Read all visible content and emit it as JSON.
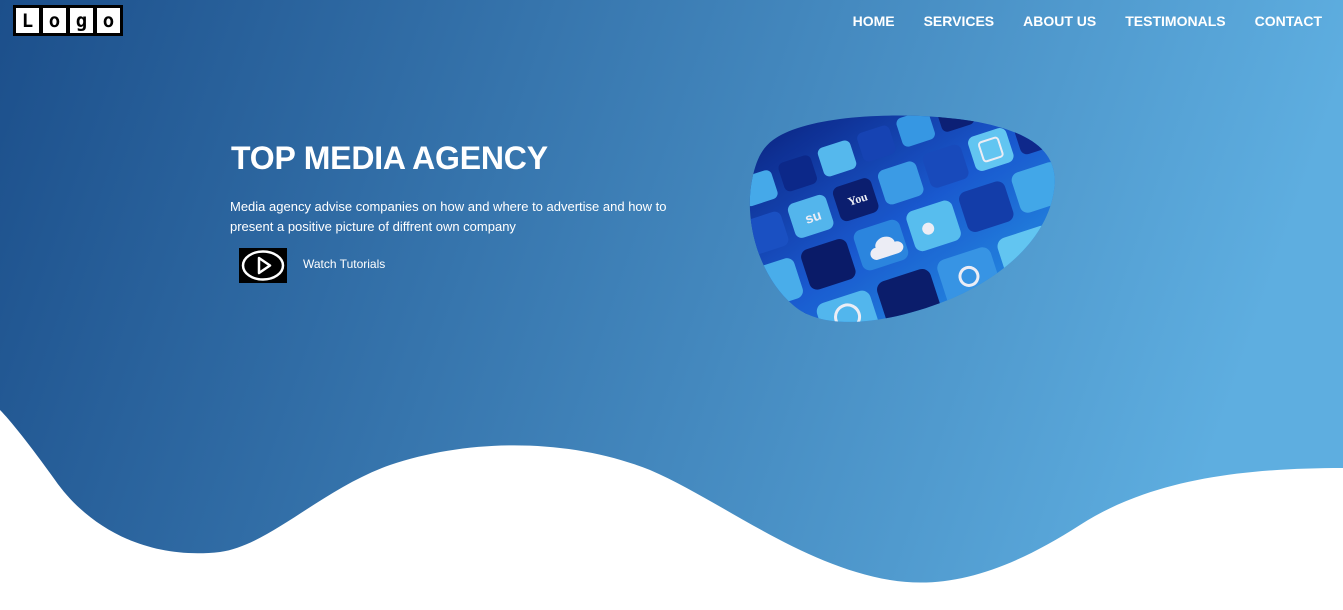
{
  "logo": {
    "letters": [
      "L",
      "o",
      "g",
      "o"
    ]
  },
  "nav": {
    "items": [
      {
        "label": "HOME"
      },
      {
        "label": "SERVICES"
      },
      {
        "label": "ABOUT US"
      },
      {
        "label": "TESTIMONALS"
      },
      {
        "label": "CONTACT"
      }
    ]
  },
  "hero": {
    "title": "TOP MEDIA AGENCY",
    "description": "Media agency advise companies on how and where to advertise and how to present a positive picture of diffrent own company",
    "watch_label": "Watch Tutorials",
    "play_icon": "play-circle-icon",
    "image_subject": "social-media-app-icons"
  },
  "colors": {
    "gradient_start": "#1c4f8b",
    "gradient_end": "#5eaee0",
    "text": "#ffffff",
    "wave": "#ffffff"
  }
}
